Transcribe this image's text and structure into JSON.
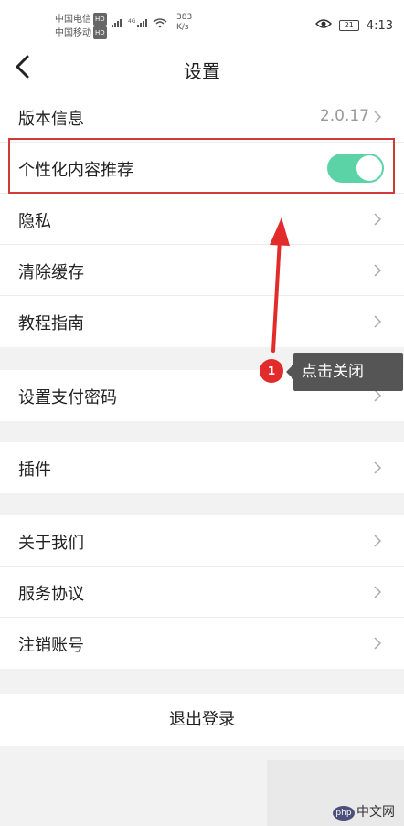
{
  "status_bar": {
    "carrier_1": "中国电信",
    "carrier_2": "中国移动",
    "hd_label": "HD",
    "signal_label": "4G",
    "speed_value": "383",
    "speed_unit": "K/s",
    "battery": "21",
    "time": "4:13"
  },
  "header": {
    "title": "设置"
  },
  "settings": {
    "group1": [
      {
        "label": "版本信息",
        "value": "2.0.17"
      },
      {
        "label": "个性化内容推荐",
        "toggle": true
      },
      {
        "label": "隐私"
      },
      {
        "label": "清除缓存"
      },
      {
        "label": "教程指南"
      }
    ],
    "group2": [
      {
        "label": "设置支付密码"
      }
    ],
    "group3": [
      {
        "label": "插件"
      }
    ],
    "group4": [
      {
        "label": "关于我们"
      },
      {
        "label": "服务协议"
      },
      {
        "label": "注销账号"
      }
    ],
    "logout": "退出登录"
  },
  "annotation": {
    "badge": "1",
    "tooltip": "点击关闭",
    "highlight_color": "#d23a3a"
  },
  "watermark": {
    "logo": "php",
    "text": "中文网"
  },
  "colors": {
    "toggle_on": "#5cd3a6",
    "background": "#f2f2f2"
  }
}
